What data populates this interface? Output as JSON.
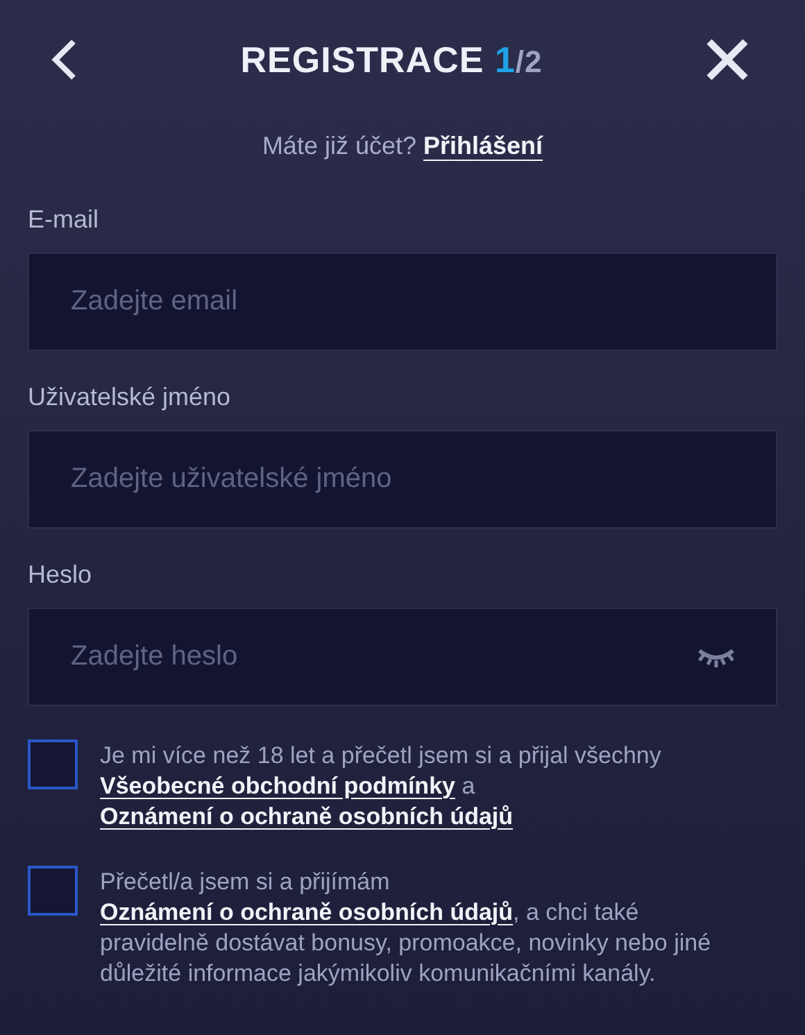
{
  "header": {
    "title": "REGISTRACE",
    "step": "1",
    "total": "/2"
  },
  "login_prompt": {
    "text": "Máte již účet?",
    "link": "Přihlášení"
  },
  "fields": [
    {
      "label": "E-mail",
      "placeholder": "Zadejte email",
      "kind": "text"
    },
    {
      "label": "Uživatelské jméno",
      "placeholder": "Zadejte uživatelské jméno",
      "kind": "text"
    },
    {
      "label": "Heslo",
      "placeholder": "Zadejte heslo",
      "kind": "password"
    }
  ],
  "consents": [
    {
      "checked": false,
      "parts": [
        {
          "kind": "text",
          "text": "Je mi více než 18 let a přečetl jsem si a přijal všechny "
        },
        {
          "kind": "link",
          "text": "Všeobecné obchodní podmínky"
        },
        {
          "kind": "text",
          "text": " a "
        },
        {
          "kind": "link",
          "text": "Oznámení o ochraně osobních údajů"
        }
      ]
    },
    {
      "checked": false,
      "parts": [
        {
          "kind": "text",
          "text": "Přečetl/a jsem si a přijímám "
        },
        {
          "kind": "link",
          "text": "Oznámení o ochraně osobních údajů"
        },
        {
          "kind": "text",
          "text": ", a chci také pravidelně dostávat bonusy, promoakce, novinky nebo jiné důležité informace jakýmikoliv komunikačními kanály."
        }
      ]
    }
  ]
}
